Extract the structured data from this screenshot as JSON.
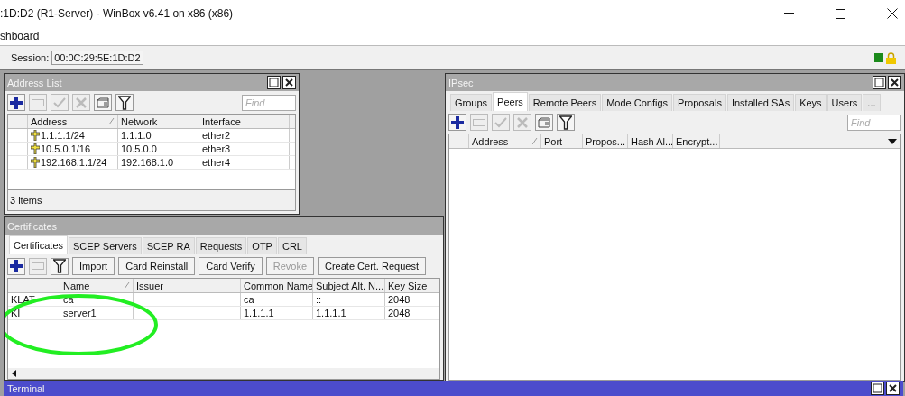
{
  "window": {
    "title": ":1D:D2 (R1-Server) - WinBox v6.41 on x86 (x86)"
  },
  "menu": {
    "item": "shboard"
  },
  "session": {
    "label": "Session:",
    "value": "00:0C:29:5E:1D:D2"
  },
  "address_list": {
    "title": "Address List",
    "tools": [
      {
        "kind": "add",
        "disabled": false
      },
      {
        "kind": "remove",
        "disabled": true
      },
      {
        "kind": "enable",
        "disabled": true
      },
      {
        "kind": "disable",
        "disabled": true
      },
      {
        "kind": "comment",
        "disabled": false
      },
      {
        "kind": "filter",
        "disabled": false
      }
    ],
    "find": {
      "placeholder": "Find"
    },
    "columns": [
      {
        "label": "Address",
        "sorted": true
      },
      {
        "label": "Network",
        "sorted": false
      },
      {
        "label": "Interface",
        "sorted": false
      }
    ],
    "rows": [
      {
        "address": "1.1.1.1/24",
        "network": "1.1.1.0",
        "interface": "ether2"
      },
      {
        "address": "10.5.0.1/16",
        "network": "10.5.0.0",
        "interface": "ether3"
      },
      {
        "address": "192.168.1.1/24",
        "network": "192.168.1.0",
        "interface": "ether4"
      }
    ],
    "status": "3 items"
  },
  "ipsec": {
    "title": "IPsec",
    "tabs": [
      {
        "label": "Groups",
        "selected": false
      },
      {
        "label": "Peers",
        "selected": true
      },
      {
        "label": "Remote Peers",
        "selected": false
      },
      {
        "label": "Mode Configs",
        "selected": false
      },
      {
        "label": "Proposals",
        "selected": false
      },
      {
        "label": "Installed SAs",
        "selected": false
      },
      {
        "label": "Keys",
        "selected": false
      },
      {
        "label": "Users",
        "selected": false
      },
      {
        "label": "...",
        "selected": false
      }
    ],
    "tools": [
      {
        "kind": "add",
        "disabled": false
      },
      {
        "kind": "remove",
        "disabled": true
      },
      {
        "kind": "enable",
        "disabled": true
      },
      {
        "kind": "disable",
        "disabled": true
      },
      {
        "kind": "comment",
        "disabled": false
      },
      {
        "kind": "filter",
        "disabled": false
      }
    ],
    "find": {
      "placeholder": "Find"
    },
    "columns": [
      {
        "label": "Address",
        "sorted": true
      },
      {
        "label": "Port",
        "sorted": false
      },
      {
        "label": "Propos...",
        "sorted": false
      },
      {
        "label": "Hash Al...",
        "sorted": false
      },
      {
        "label": "Encrypt...",
        "sorted": false
      }
    ]
  },
  "certificates": {
    "title": "Certificates",
    "tabs": [
      {
        "label": "Certificates",
        "selected": true
      },
      {
        "label": "SCEP Servers",
        "selected": false
      },
      {
        "label": "SCEP RA",
        "selected": false
      },
      {
        "label": "Requests",
        "selected": false
      },
      {
        "label": "OTP",
        "selected": false
      },
      {
        "label": "CRL",
        "selected": false
      }
    ],
    "tools": [
      {
        "kind": "add",
        "disabled": false
      },
      {
        "kind": "remove",
        "disabled": true
      },
      {
        "kind": "filter",
        "disabled": false
      }
    ],
    "buttons": [
      {
        "label": "Import",
        "disabled": false
      },
      {
        "label": "Card Reinstall",
        "disabled": false
      },
      {
        "label": "Card Verify",
        "disabled": false
      },
      {
        "label": "Revoke",
        "disabled": true
      },
      {
        "label": "Create Cert. Request",
        "disabled": false
      }
    ],
    "columns": [
      {
        "label": "Name",
        "sorted": true
      },
      {
        "label": "Issuer",
        "sorted": false
      },
      {
        "label": "Common Name",
        "sorted": false
      },
      {
        "label": "Subject Alt. N...",
        "sorted": false
      },
      {
        "label": "Key Size",
        "sorted": false
      }
    ],
    "rows": [
      {
        "flags": "KLAT",
        "cells": [
          "ca",
          null,
          "ca",
          "::",
          "2048"
        ]
      },
      {
        "flags": "KI",
        "cells": [
          "server1",
          null,
          "1.1.1.1",
          "1.1.1.1",
          "2048"
        ]
      }
    ]
  },
  "terminal": {
    "title": "Terminal"
  }
}
